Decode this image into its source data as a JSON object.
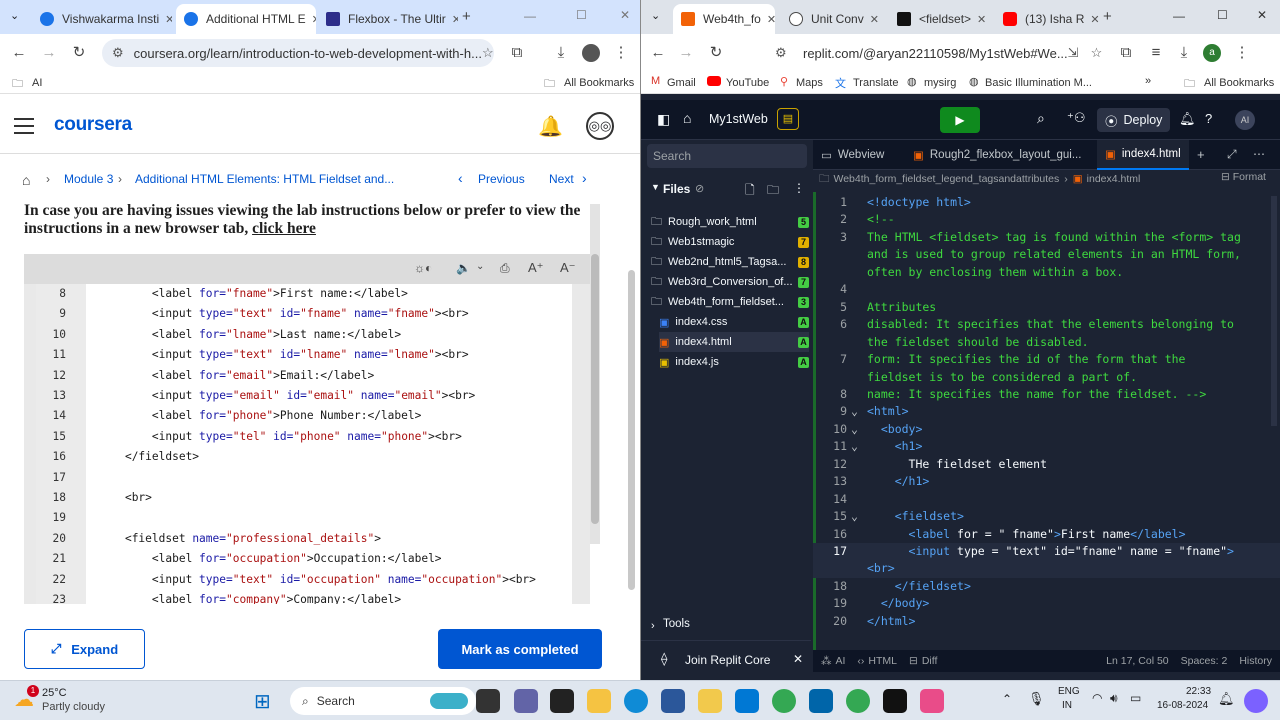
{
  "left_browser": {
    "tabs": [
      {
        "title": "Vishwakarma Insti",
        "color": "#1a73e8"
      },
      {
        "title": "Additional HTML E",
        "color": "#1a73e8"
      },
      {
        "title": "Flexbox - The Ultir",
        "color": "#2d2d8a"
      }
    ],
    "url": "coursera.org/learn/introduction-to-web-development-with-h...",
    "bookmarks_left": "AI",
    "bookmarks_right": "All Bookmarks"
  },
  "coursera": {
    "logo": "coursera",
    "breadcrumb": {
      "module": "Module 3",
      "page": "Additional HTML Elements: HTML Fieldset and..."
    },
    "previous": "Previous",
    "next": "Next",
    "instruction_text": "In case you are having issues viewing the lab instructions below or prefer to view the instructions in a new browser tab, ",
    "instruction_link": "click here",
    "code_lines": [
      {
        "n": "8",
        "html": "        <span class='tag'>&lt;label </span><span class='att'>for=</span><span class='val'>\"fname\"</span><span class='tag'>&gt;First name:&lt;/label&gt;</span>"
      },
      {
        "n": "9",
        "html": "        <span class='tag'>&lt;input </span><span class='att'>type=</span><span class='val'>\"text\"</span> <span class='att'>id=</span><span class='val'>\"fname\"</span> <span class='att'>name=</span><span class='val'>\"fname\"</span><span class='tag'>&gt;&lt;br&gt;</span>"
      },
      {
        "n": "10",
        "html": "        <span class='tag'>&lt;label </span><span class='att'>for=</span><span class='val'>\"lname\"</span><span class='tag'>&gt;Last name:&lt;/label&gt;</span>"
      },
      {
        "n": "11",
        "html": "        <span class='tag'>&lt;input </span><span class='att'>type=</span><span class='val'>\"text\"</span> <span class='att'>id=</span><span class='val'>\"lname\"</span> <span class='att'>name=</span><span class='val'>\"lname\"</span><span class='tag'>&gt;&lt;br&gt;</span>"
      },
      {
        "n": "12",
        "html": "        <span class='tag'>&lt;label </span><span class='att'>for=</span><span class='val'>\"email\"</span><span class='tag'>&gt;Email:&lt;/label&gt;</span>"
      },
      {
        "n": "13",
        "html": "        <span class='tag'>&lt;input </span><span class='att'>type=</span><span class='val'>\"email\"</span> <span class='att'>id=</span><span class='val'>\"email\"</span> <span class='att'>name=</span><span class='val'>\"email\"</span><span class='tag'>&gt;&lt;br&gt;</span>"
      },
      {
        "n": "14",
        "html": "        <span class='tag'>&lt;label </span><span class='att'>for=</span><span class='val'>\"phone\"</span><span class='tag'>&gt;Phone Number:&lt;/label&gt;</span>"
      },
      {
        "n": "15",
        "html": "        <span class='tag'>&lt;input </span><span class='att'>type=</span><span class='val'>\"tel\"</span> <span class='att'>id=</span><span class='val'>\"phone\"</span> <span class='att'>name=</span><span class='val'>\"phone\"</span><span class='tag'>&gt;&lt;br&gt;</span>"
      },
      {
        "n": "16",
        "html": "    <span class='tag'>&lt;/fieldset&gt;</span>"
      },
      {
        "n": "17",
        "html": ""
      },
      {
        "n": "18",
        "html": "    <span class='tag'>&lt;br&gt;</span>"
      },
      {
        "n": "19",
        "html": ""
      },
      {
        "n": "20",
        "html": "    <span class='tag'>&lt;fieldset </span><span class='att'>name=</span><span class='val'>\"professional_details\"</span><span class='tag'>&gt;</span>"
      },
      {
        "n": "21",
        "html": "        <span class='tag'>&lt;label </span><span class='att'>for=</span><span class='val'>\"occupation\"</span><span class='tag'>&gt;Occupation:&lt;/label&gt;</span>"
      },
      {
        "n": "22",
        "html": "        <span class='tag'>&lt;input </span><span class='att'>type=</span><span class='val'>\"text\"</span> <span class='att'>id=</span><span class='val'>\"occupation\"</span> <span class='att'>name=</span><span class='val'>\"occupation\"</span><span class='tag'>&gt;&lt;br&gt;</span>"
      },
      {
        "n": "23",
        "html": "        <span class='tag'>&lt;label </span><span class='att'>for=</span><span class='val'>\"company\"</span><span class='tag'>&gt;Company:&lt;/label&gt;</span>"
      }
    ],
    "expand_label": "Expand",
    "mark_completed_label": "Mark as completed"
  },
  "right_browser": {
    "tabs": [
      {
        "title": "Web4th_fo",
        "color": "#f26207"
      },
      {
        "title": "Unit Conv",
        "color": "#4a4a4a"
      },
      {
        "title": "<fieldset>",
        "color": "#111111"
      },
      {
        "title": "(13) Isha R",
        "color": "#ff0000"
      }
    ],
    "url": "replit.com/@aryan22110598/My1stWeb#We...",
    "bookmarks": [
      "Gmail",
      "YouTube",
      "Maps",
      "Translate",
      "mysirg",
      "Basic Illumination M..."
    ],
    "bookmarks_right": "All Bookmarks"
  },
  "replit": {
    "project": "My1stWeb",
    "deploy": "Deploy",
    "search_placeholder": "Search",
    "files_label": "Files",
    "files": [
      {
        "name": "Rough_work_html",
        "badge": "5",
        "type": "folder",
        "badge_color": "#44cc44"
      },
      {
        "name": "Web1stmagic",
        "badge": "7",
        "type": "folder",
        "badge_color": "#e0b000"
      },
      {
        "name": "Web2nd_html5_Tagsa...",
        "badge": "8",
        "type": "folder",
        "badge_color": "#e0b000"
      },
      {
        "name": "Web3rd_Conversion_of...",
        "badge": "7",
        "type": "folder",
        "badge_color": "#44cc44"
      },
      {
        "name": "Web4th_form_fieldset...",
        "badge": "3",
        "type": "folder",
        "badge_color": "#44cc44"
      },
      {
        "name": "index4.css",
        "badge": "A",
        "type": "css",
        "badge_color": "#44cc44"
      },
      {
        "name": "index4.html",
        "badge": "A",
        "type": "html",
        "badge_color": "#44cc44"
      },
      {
        "name": "index4.js",
        "badge": "A",
        "type": "js",
        "badge_color": "#44cc44"
      }
    ],
    "tools_label": "Tools",
    "join_label": "Join Replit Core",
    "editor_tabs": [
      "Webview",
      "Rough2_flexbox_layout_gui...",
      "index4.html"
    ],
    "path_folder": "Web4th_form_fieldset_legend_tagsandattributes",
    "path_file": "index4.html",
    "format_label": "Format",
    "code": [
      {
        "n": "1",
        "f": "",
        "html": "<span class='tg'>&lt;!doctype html&gt;</span>"
      },
      {
        "n": "2",
        "f": "",
        "html": "<span class='cm'>&lt;!--</span>"
      },
      {
        "n": "3",
        "f": "",
        "html": "<span class='cm'>The HTML &lt;fieldset&gt; tag is found within the &lt;form&gt; tag</span>"
      },
      {
        "n": "",
        "f": "",
        "html": "<span class='cm'>and is used to group related elements in an HTML form,</span>"
      },
      {
        "n": "",
        "f": "",
        "html": "<span class='cm'>often by enclosing them within a box.</span>"
      },
      {
        "n": "4",
        "f": "",
        "html": ""
      },
      {
        "n": "5",
        "f": "",
        "html": "<span class='cm'>Attributes</span>"
      },
      {
        "n": "6",
        "f": "",
        "html": "<span class='cm'>disabled: It specifies that the elements belonging to</span>"
      },
      {
        "n": "",
        "f": "",
        "html": "<span class='cm'>the fieldset should be disabled.</span>"
      },
      {
        "n": "7",
        "f": "",
        "html": "<span class='cm'>form: It specifies the id of the form that the</span>"
      },
      {
        "n": "",
        "f": "",
        "html": "<span class='cm'>fieldset is to be considered a part of.</span>"
      },
      {
        "n": "8",
        "f": "",
        "html": "<span class='cm'>name: It specifies the name for the fieldset. --&gt;</span>"
      },
      {
        "n": "9",
        "f": "⌄",
        "html": "<span class='tg'>&lt;html&gt;</span>"
      },
      {
        "n": "10",
        "f": "⌄",
        "html": "  <span class='tg'>&lt;body&gt;</span>"
      },
      {
        "n": "11",
        "f": "⌄",
        "html": "    <span class='tg'>&lt;h1&gt;</span>"
      },
      {
        "n": "12",
        "f": "",
        "html": "      THe fieldset element"
      },
      {
        "n": "13",
        "f": "",
        "html": "    <span class='tg'>&lt;/h1&gt;</span>"
      },
      {
        "n": "14",
        "f": "",
        "html": ""
      },
      {
        "n": "15",
        "f": "⌄",
        "html": "    <span class='tg'>&lt;fieldset&gt;</span>"
      },
      {
        "n": "16",
        "f": "",
        "html": "      <span class='tg'>&lt;label</span> for = \" fname\"<span class='tg'>&gt;</span>First name<span class='tg'>&lt;/label&gt;</span>"
      },
      {
        "n": "17",
        "f": "",
        "html": "      <span class='tg'>&lt;input</span> type = \"text\" id=\"fname\" name = \"fname\"<span class='tg'>&gt;</span>"
      },
      {
        "n": "",
        "f": "",
        "html": "<span class='tg'>&lt;br&gt;</span>"
      },
      {
        "n": "18",
        "f": "",
        "html": "    <span class='tg'>&lt;/fieldset&gt;</span>"
      },
      {
        "n": "19",
        "f": "",
        "html": "  <span class='tg'>&lt;/body&gt;</span>"
      },
      {
        "n": "20",
        "f": "",
        "html": "<span class='tg'>&lt;/html&gt;</span>"
      }
    ],
    "status": {
      "ai": "AI",
      "lang": "HTML",
      "diff": "Diff",
      "pos": "Ln 17, Col 50",
      "spaces": "Spaces: 2",
      "history": "History"
    }
  },
  "taskbar": {
    "weather_temp": "25°C",
    "weather_desc": "Partly cloudy",
    "weather_badge": "1",
    "search": "Search",
    "lang1": "ENG",
    "lang2": "IN",
    "time": "22:33",
    "date": "16-08-2024"
  }
}
